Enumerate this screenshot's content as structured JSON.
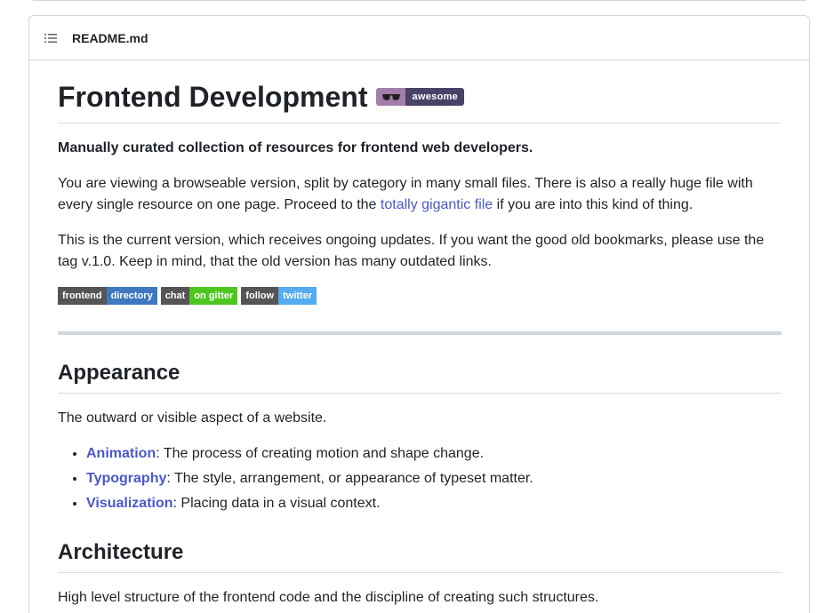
{
  "header": {
    "file_name": "README.md",
    "icons": {
      "toc": "list-unordered-icon"
    }
  },
  "title": {
    "text": "Frontend Development",
    "badge": {
      "icon": "sunglasses-icon",
      "label": "awesome"
    }
  },
  "intro": {
    "lead": "Manually curated collection of resources for frontend web developers.",
    "para1_part1": "You are viewing a browseable version, split by category in many small files. There is also a really huge file with every single resource on one page. Proceed to the ",
    "para1_link": "totally gigantic file",
    "para1_part2": " if you are into this kind of thing.",
    "para2": "This is the current version, which receives ongoing updates. If you want the good old bookmarks, please use the tag v.1.0. Keep in mind, that the old version has many outdated links."
  },
  "badges": [
    {
      "left": "frontend",
      "right": "directory",
      "color": "#4078c0"
    },
    {
      "left": "chat",
      "right": "on gitter",
      "color": "#4dc71f"
    },
    {
      "left": "follow",
      "right": "twitter",
      "color": "#55acee"
    }
  ],
  "sections": {
    "appearance": {
      "heading": "Appearance",
      "description": "The outward or visible aspect of a website.",
      "items": [
        {
          "link": "Animation",
          "text": ": The process of creating motion and shape change."
        },
        {
          "link": "Typography",
          "text": ": The style, arrangement, or appearance of typeset matter."
        },
        {
          "link": "Visualization",
          "text": ": Placing data in a visual context."
        }
      ]
    },
    "architecture": {
      "heading": "Architecture",
      "description": "High level structure of the frontend code and the discipline of creating such structures."
    }
  },
  "colors": {
    "link": "#4b58c9",
    "text": "#1f2328",
    "border": "#d0d7de"
  }
}
